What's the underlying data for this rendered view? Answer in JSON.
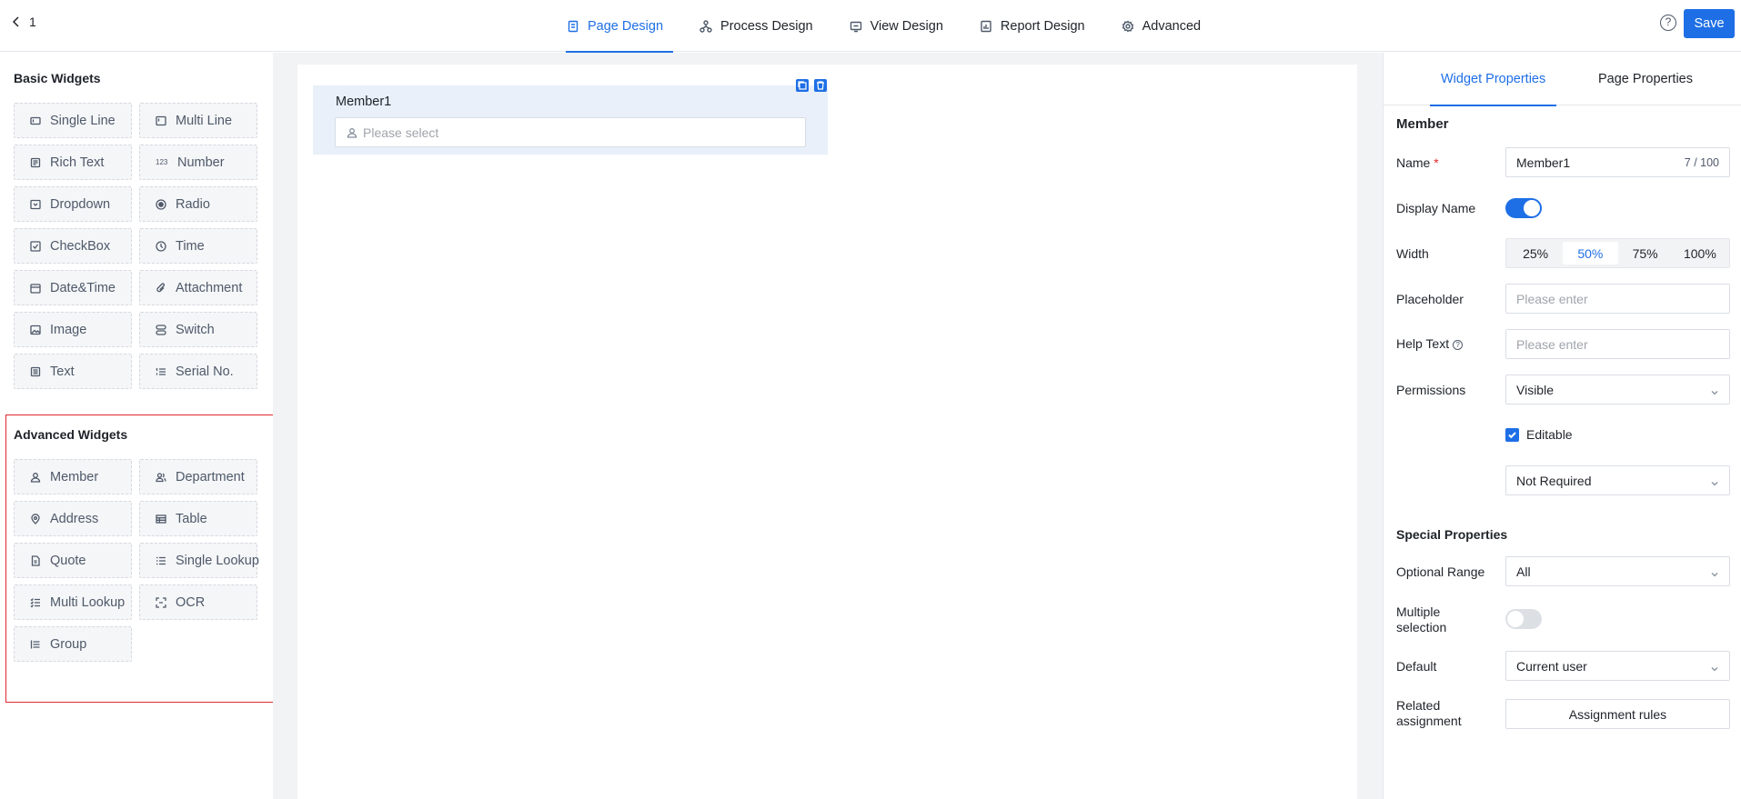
{
  "header": {
    "back_label": "1",
    "tabs": [
      {
        "label": "Page Design",
        "icon": "page-icon",
        "active": true
      },
      {
        "label": "Process Design",
        "icon": "process-icon",
        "active": false
      },
      {
        "label": "View Design",
        "icon": "view-icon",
        "active": false
      },
      {
        "label": "Report Design",
        "icon": "report-icon",
        "active": false
      },
      {
        "label": "Advanced",
        "icon": "gear-icon",
        "active": false
      }
    ],
    "help_label": "?",
    "save_label": "Save"
  },
  "left_panel": {
    "basic_title": "Basic Widgets",
    "basic_widgets": [
      {
        "label": "Single Line",
        "icon": "single-line-icon"
      },
      {
        "label": "Multi Line",
        "icon": "multi-line-icon"
      },
      {
        "label": "Rich Text",
        "icon": "rich-text-icon"
      },
      {
        "label": "Number",
        "icon": "number-icon"
      },
      {
        "label": "Dropdown",
        "icon": "dropdown-icon"
      },
      {
        "label": "Radio",
        "icon": "radio-icon"
      },
      {
        "label": "CheckBox",
        "icon": "checkbox-icon"
      },
      {
        "label": "Time",
        "icon": "clock-icon"
      },
      {
        "label": "Date&Time",
        "icon": "calendar-icon"
      },
      {
        "label": "Attachment",
        "icon": "paperclip-icon"
      },
      {
        "label": "Image",
        "icon": "image-icon"
      },
      {
        "label": "Switch",
        "icon": "switch-icon"
      },
      {
        "label": "Text",
        "icon": "text-icon"
      },
      {
        "label": "Serial No.",
        "icon": "serial-icon"
      }
    ],
    "advanced_title": "Advanced Widgets",
    "advanced_widgets": [
      {
        "label": "Member",
        "icon": "person-icon"
      },
      {
        "label": "Department",
        "icon": "people-icon"
      },
      {
        "label": "Address",
        "icon": "location-icon"
      },
      {
        "label": "Table",
        "icon": "table-icon"
      },
      {
        "label": "Quote",
        "icon": "document-icon"
      },
      {
        "label": "Single Lookup",
        "icon": "list-icon"
      },
      {
        "label": "Multi Lookup",
        "icon": "checklist-icon"
      },
      {
        "label": "OCR",
        "icon": "scan-icon"
      },
      {
        "label": "Group",
        "icon": "group-icon"
      }
    ]
  },
  "canvas": {
    "field_name": "Member1",
    "field_placeholder": "Please select"
  },
  "right_panel": {
    "tabs": [
      "Widget Properties",
      "Page Properties"
    ],
    "widget_type": "Member",
    "name_label": "Name",
    "required_mark": "*",
    "name_value": "Member1",
    "name_counter": "7 / 100",
    "display_name_label": "Display Name",
    "width_label": "Width",
    "width_options": [
      "25%",
      "50%",
      "75%",
      "100%"
    ],
    "width_selected": "50%",
    "placeholder_label": "Placeholder",
    "placeholder_hint": "Please enter",
    "help_text_label": "Help Text",
    "help_text_hint": "Please enter",
    "permissions_label": "Permissions",
    "permissions_value": "Visible",
    "editable_label": "Editable",
    "required_value": "Not Required",
    "special_title": "Special Properties",
    "optional_range_label": "Optional Range",
    "optional_range_value": "All",
    "multiple_selection_label_1": "Multiple",
    "multiple_selection_label_2": "selection",
    "default_label": "Default",
    "default_value": "Current user",
    "related_label_1": "Related",
    "related_label_2": "assignment",
    "assignment_rules_label": "Assignment rules"
  },
  "colors": {
    "accent": "#1e6fe6",
    "highlight_border": "#e0282e"
  }
}
